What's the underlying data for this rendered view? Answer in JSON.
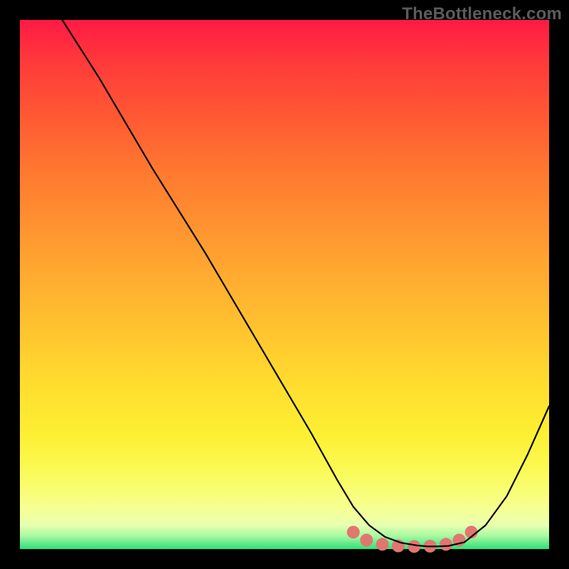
{
  "watermark": "TheBottleneck.com",
  "chart_data": {
    "type": "line",
    "title": "",
    "xlabel": "",
    "ylabel": "",
    "xlim": [
      0,
      100
    ],
    "ylim": [
      0,
      100
    ],
    "series": [
      {
        "name": "curve",
        "color": "#000000",
        "x": [
          8,
          15,
          25,
          35,
          45,
          55,
          60,
          63,
          66,
          69,
          72,
          75,
          77,
          79,
          81,
          84,
          88,
          92,
          96,
          100
        ],
        "y": [
          100,
          89,
          72,
          56,
          39,
          22,
          13,
          8,
          4.5,
          2.3,
          1.2,
          0.7,
          0.5,
          0.5,
          0.6,
          1.3,
          4.5,
          10,
          18,
          27
        ]
      }
    ],
    "markers": [
      {
        "x": 63.0,
        "y": 3.2,
        "color": "#e1766f"
      },
      {
        "x": 65.5,
        "y": 1.7,
        "color": "#e1766f"
      },
      {
        "x": 68.5,
        "y": 0.9,
        "color": "#e1766f"
      },
      {
        "x": 71.5,
        "y": 0.6,
        "color": "#e1766f"
      },
      {
        "x": 74.5,
        "y": 0.5,
        "color": "#e1766f"
      },
      {
        "x": 77.5,
        "y": 0.55,
        "color": "#e1766f"
      },
      {
        "x": 80.5,
        "y": 0.9,
        "color": "#e1766f"
      },
      {
        "x": 83.0,
        "y": 1.7,
        "color": "#e1766f"
      },
      {
        "x": 85.3,
        "y": 3.2,
        "color": "#e1766f"
      }
    ]
  }
}
